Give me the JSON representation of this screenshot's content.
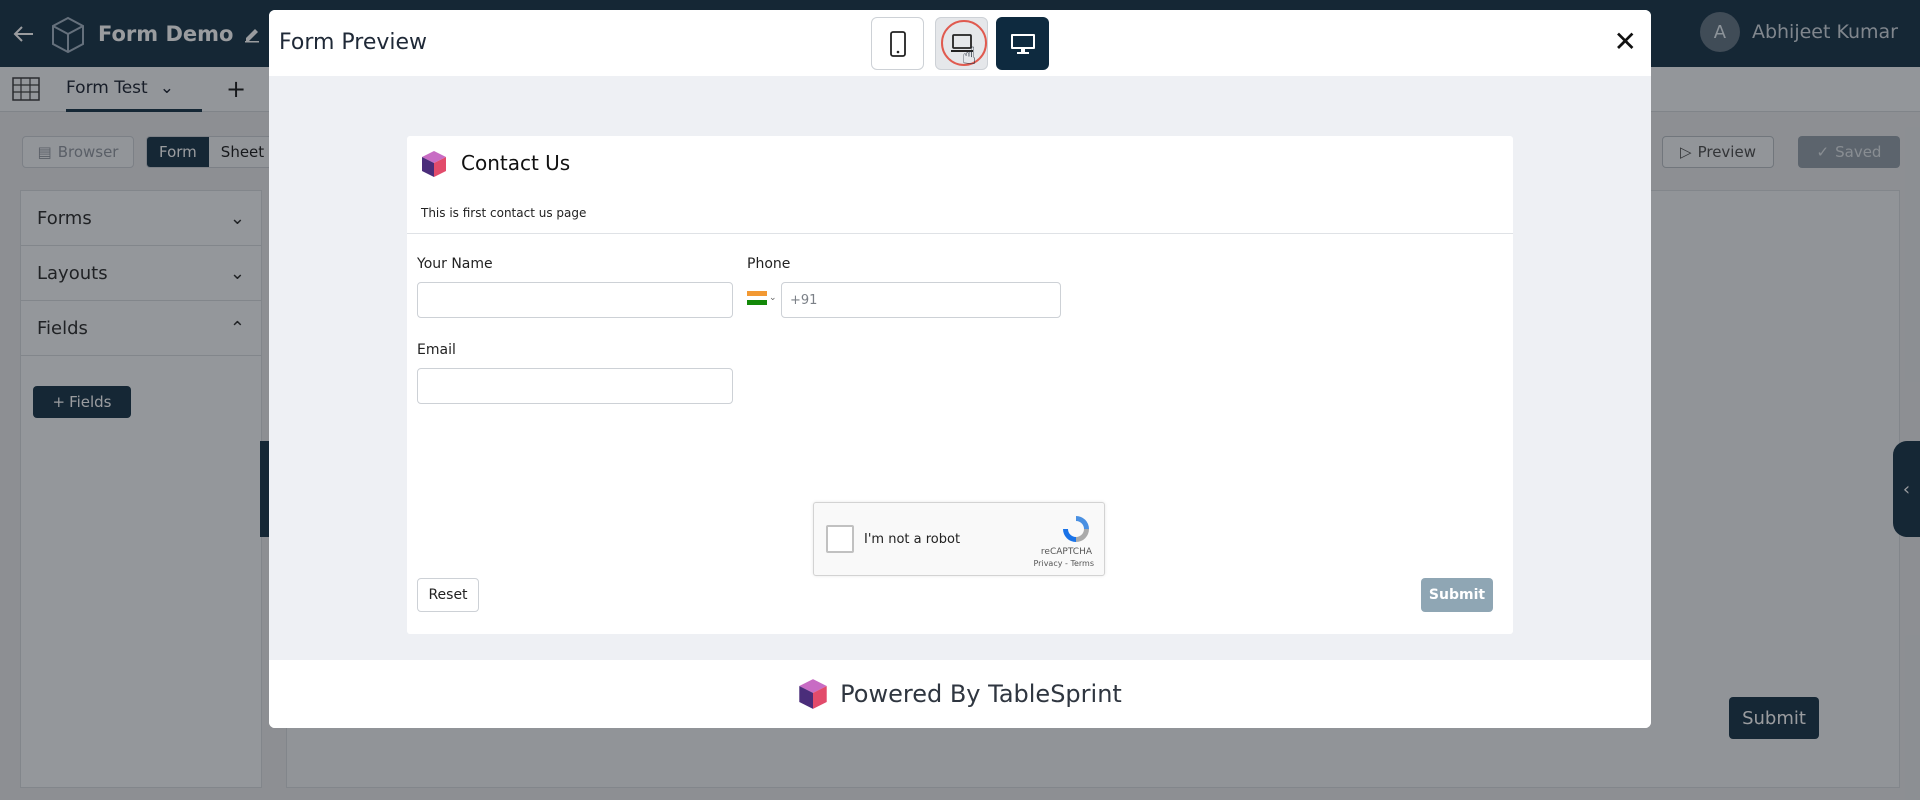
{
  "app": {
    "title": "Form Demo",
    "user": {
      "initial": "A",
      "name": "Abhijeet Kumar"
    },
    "sheet_tab": "Form Test",
    "add_tab": "+",
    "toolbar": {
      "browser": "Browser",
      "form": "Form",
      "sheet": "Sheet",
      "preview": "Preview",
      "saved": "Saved"
    },
    "sidebar": {
      "items": [
        "Forms",
        "Layouts",
        "Fields"
      ],
      "fields_button": "Fields"
    },
    "background_submit": "Submit"
  },
  "modal": {
    "title": "Form Preview",
    "devices": [
      "mobile-icon",
      "tablet-icon",
      "desktop-icon"
    ],
    "active_device": "desktop",
    "close": "✕",
    "form": {
      "title": "Contact Us",
      "description": "This is first contact us page",
      "fields": {
        "name_label": "Your Name",
        "phone_label": "Phone",
        "phone_value": "+91",
        "email_label": "Email"
      },
      "captcha": {
        "text": "I'm not a robot",
        "brand": "reCAPTCHA",
        "links": "Privacy - Terms"
      },
      "reset": "Reset",
      "submit": "Submit"
    },
    "footer": "Powered By TableSprint"
  },
  "colors": {
    "primary": "#0e2a3f",
    "submit_disabled": "#8fa6b4",
    "cursor_ring": "#e05a4f"
  }
}
